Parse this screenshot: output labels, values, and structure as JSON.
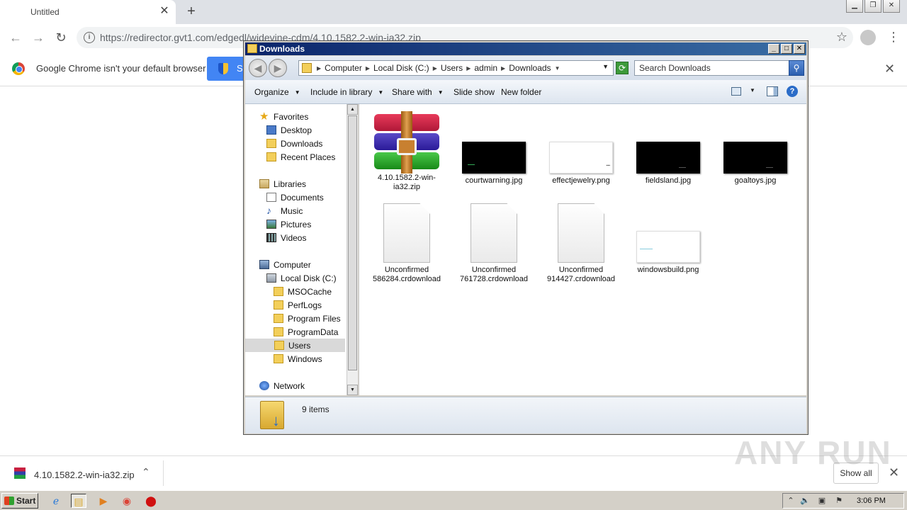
{
  "browser": {
    "tab_title": "Untitled",
    "tab_close": "✕",
    "new_tab": "+",
    "url": "https://redirector.gvt1.com/edgedl/widevine-cdm/4.10.1582.2-win-ia32.zip",
    "infobar_text": "Google Chrome isn't your default browser",
    "infobar_button": "Set as default"
  },
  "explorer": {
    "title": "Downloads",
    "breadcrumbs": [
      "Computer",
      "Local Disk (C:)",
      "Users",
      "admin",
      "Downloads"
    ],
    "search_placeholder": "Search Downloads",
    "commands": {
      "organize": "Organize",
      "include_in_library": "Include in library",
      "share_with": "Share with",
      "slide_show": "Slide show",
      "new_folder": "New folder"
    },
    "nav": {
      "favorites": "Favorites",
      "desktop": "Desktop",
      "downloads": "Downloads",
      "recent_places": "Recent Places",
      "libraries": "Libraries",
      "documents": "Documents",
      "music": "Music",
      "pictures": "Pictures",
      "videos": "Videos",
      "computer": "Computer",
      "local_disk": "Local Disk (C:)",
      "msocache": "MSOCache",
      "perflogs": "PerfLogs",
      "program_files": "Program Files",
      "programdata": "ProgramData",
      "users": "Users",
      "windows": "Windows",
      "network": "Network"
    },
    "files": [
      "4.10.1582.2-win-ia32.zip",
      "courtwarning.jpg",
      "effectjewelry.png",
      "fieldsland.jpg",
      "goaltoys.jpg",
      "Unconfirmed 586284.crdownload",
      "Unconfirmed 761728.crdownload",
      "Unconfirmed 914427.crdownload",
      "windowsbuild.png"
    ],
    "status": "9 items"
  },
  "download_shelf": {
    "file": "4.10.1582.2-win-ia32.zip",
    "show_all": "Show all"
  },
  "watermark": "ANY RUN",
  "taskbar": {
    "start": "Start",
    "clock": "3:06 PM"
  }
}
